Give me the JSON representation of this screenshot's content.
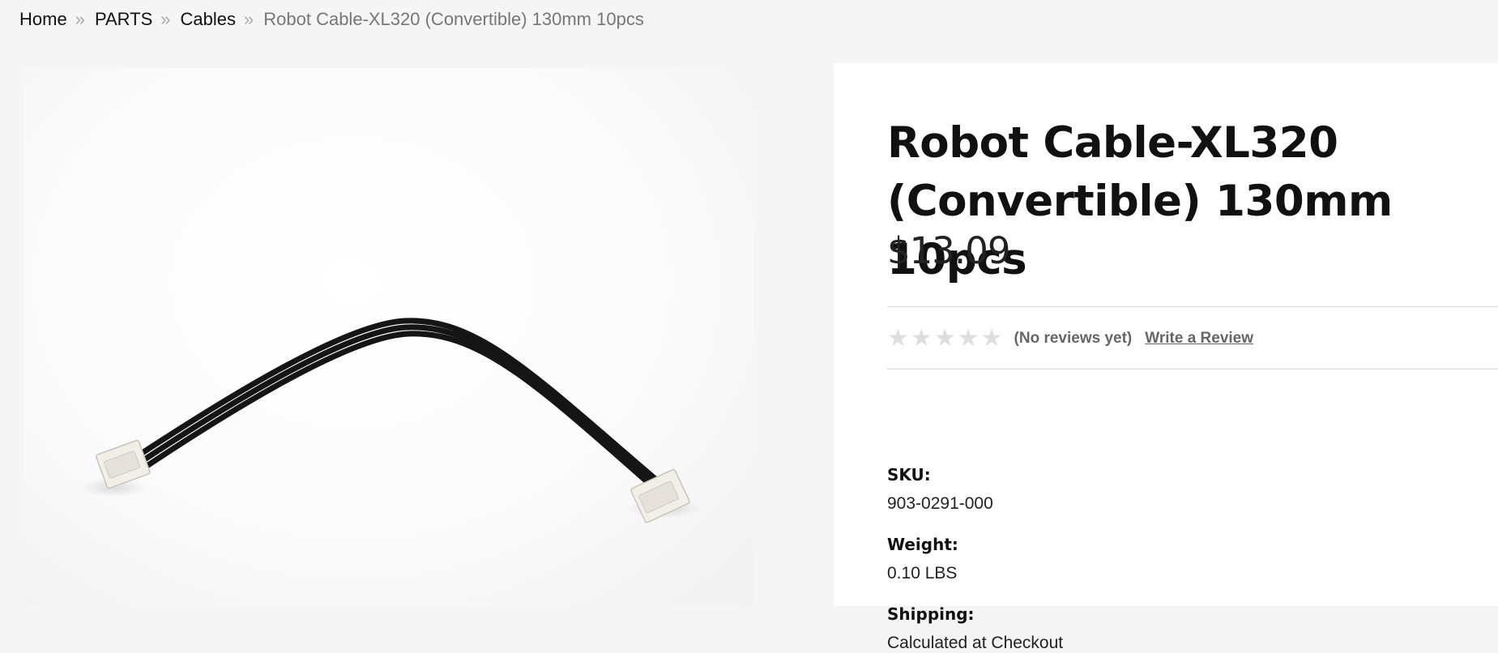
{
  "breadcrumb": {
    "items": [
      {
        "label": "Home"
      },
      {
        "label": "PARTS"
      },
      {
        "label": "Cables"
      }
    ],
    "current": "Robot Cable-XL320 (Convertible) 130mm 10pcs",
    "separator": "»"
  },
  "product": {
    "title": "Robot Cable-XL320 (Convertible) 130mm 10pcs",
    "price": "$13.09",
    "rating": {
      "stars_filled": 0,
      "stars_total": 5,
      "no_reviews_text": "(No reviews yet)",
      "write_review_label": "Write a Review"
    },
    "specs": {
      "sku": {
        "label": "SKU:",
        "value": "903-0291-000"
      },
      "weight": {
        "label": "Weight:",
        "value": "0.10 LBS"
      },
      "shipping": {
        "label": "Shipping:",
        "value": "Calculated at Checkout"
      }
    }
  },
  "icons": {
    "star": "star-icon",
    "separator": "double-chevron-right-icon"
  },
  "colors": {
    "page_background": "#f5f5f5",
    "panel_background": "#ffffff",
    "star_empty": "#dedede",
    "muted_text": "#666666"
  }
}
